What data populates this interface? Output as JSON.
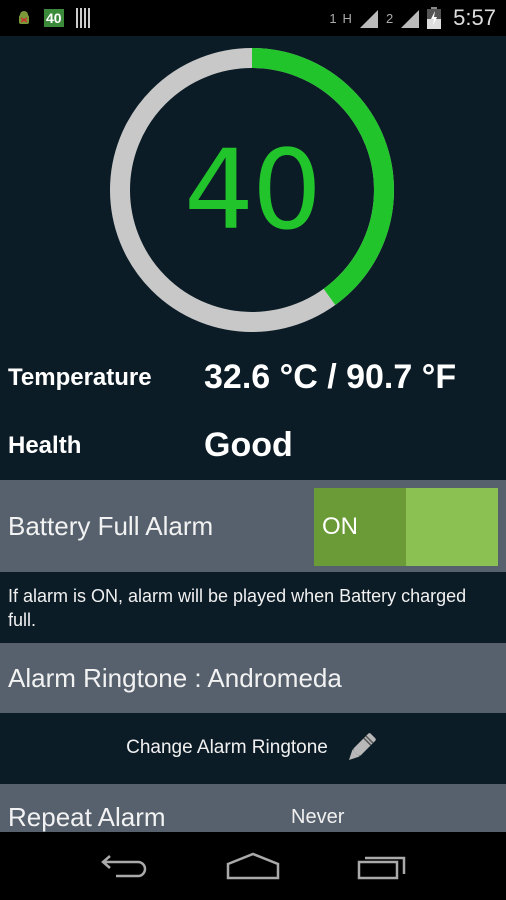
{
  "status_bar": {
    "notification_icons": [
      "android-debug-icon",
      "battery-percent-badge",
      "barcode-icon"
    ],
    "battery_badge_text": "40",
    "sim1_label": "1",
    "sim2_label": "2",
    "network_type": "H",
    "time": "5:57"
  },
  "gauge": {
    "value": "40",
    "percent": 40,
    "accent_color": "#22c42c",
    "track_color": "#c8c8c8"
  },
  "info": {
    "temperature_label": "Temperature",
    "temperature_value": "32.6 °C / 90.7 °F",
    "health_label": "Health",
    "health_value": "Good"
  },
  "alarm": {
    "label": "Battery Full Alarm",
    "toggle_state": "ON",
    "description": "If alarm is ON, alarm will be played when Battery charged full."
  },
  "ringtone": {
    "label": "Alarm Ringtone : Andromeda",
    "change_button_label": "Change Alarm Ringtone"
  },
  "repeat": {
    "label": "Repeat Alarm",
    "value": "Never"
  },
  "nav": {
    "back": "back-icon",
    "home": "home-icon",
    "recents": "recents-icon"
  }
}
